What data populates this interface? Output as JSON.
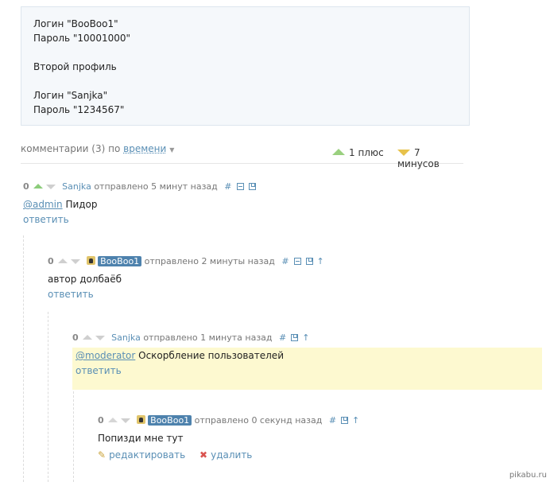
{
  "quote": {
    "lines": [
      "Логин \"BooBoo1\"",
      "Пароль \"10001000\"",
      "",
      "Второй профиль",
      "",
      "Логин \"Sanjka\"",
      "Пароль \"1234567\""
    ]
  },
  "comments_bar": {
    "count_label": "комментарии (3) по",
    "sort_label": "времени",
    "plus_label": "1 плюс",
    "minus_label": "7 минусов"
  },
  "comments": [
    {
      "rating": "0",
      "author": "Sanjka",
      "sent": "отправлено",
      "time": "5 минут назад",
      "mention": "@admin",
      "text": "Пидор",
      "reply": "ответить"
    },
    {
      "rating": "0",
      "author": "BooBoo1",
      "sent": "отправлено",
      "time": "2 минуты назад",
      "mention": "",
      "text": "автор долбаёб",
      "reply": "ответить"
    },
    {
      "rating": "0",
      "author": "Sanjka",
      "sent": "отправлено",
      "time": "1 минута назад",
      "mention": "@moderator",
      "text": "Оскорбление пользователей",
      "reply": "ответить"
    },
    {
      "rating": "0",
      "author": "BooBoo1",
      "sent": "отправлено",
      "time": "0 секунд назад",
      "mention": "",
      "text": "Попизди мне тут",
      "edit": "редактировать",
      "delete": "удалить"
    }
  ],
  "watermark": "pikabu.ru",
  "colors": {
    "link": "#5a8fb5",
    "highlight": "#fdf9d0",
    "upvote": "#9ad07f",
    "downvote": "#e7c24b"
  }
}
